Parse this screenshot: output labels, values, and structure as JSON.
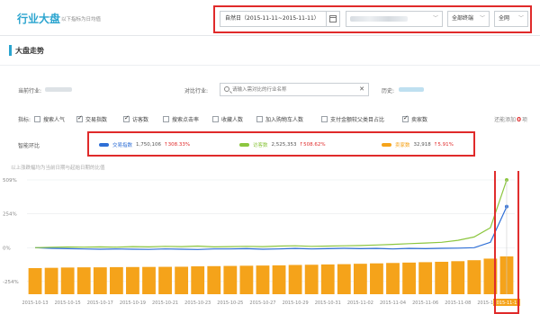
{
  "header": {
    "title": "行业大盘",
    "subtitle": "以下指标为日均值",
    "date_range": "自然日（2015-11-11~2015-11-11）",
    "industry_placeholder": "",
    "terminal_select": "全部终端",
    "scope_select": "全网"
  },
  "section": {
    "title": "大盘走势"
  },
  "filters": {
    "current_industry_label": "当前行业:",
    "compare_industry_label": "对比行业:",
    "compare_search_placeholder": "请输入需对比的行业名称",
    "history_label": "历史:"
  },
  "metrics": {
    "label": "指标:",
    "items": [
      {
        "label": "搜索人气",
        "checked": false
      },
      {
        "label": "交易指数",
        "checked": true
      },
      {
        "label": "访客数",
        "checked": true
      },
      {
        "label": "搜索点击率",
        "checked": false
      },
      {
        "label": "收藏人数",
        "checked": false
      },
      {
        "label": "加入购物车人数",
        "checked": false
      },
      {
        "label": "支付金额较父类目占比",
        "checked": false
      },
      {
        "label": "卖家数",
        "checked": true
      }
    ],
    "count_prefix": "还能添加",
    "count": "0",
    "count_suffix": "项"
  },
  "smart_compare": {
    "label": "智能环比",
    "series": [
      {
        "name": "交易指数",
        "value": "1,750,106",
        "change": "↑308.33%",
        "color": "#2f6fd6"
      },
      {
        "name": "访客数",
        "value": "2,525,353",
        "change": "↑508.62%",
        "color": "#8cc63f"
      },
      {
        "name": "卖家数",
        "value": "32,918",
        "change": "↑5.91%",
        "color": "#f5a31a"
      }
    ]
  },
  "chart_data": {
    "type": "bar",
    "note": "以上涨跌幅均为当前日期与起始日期的比值",
    "y_ticks": [
      "509%",
      "254%",
      "0%",
      "-254%"
    ],
    "ylim": [
      -350,
      509
    ],
    "x": [
      "2015-10-13",
      "2015-10-14",
      "2015-10-15",
      "2015-10-16",
      "2015-10-17",
      "2015-10-18",
      "2015-10-19",
      "2015-10-20",
      "2015-10-21",
      "2015-10-22",
      "2015-10-23",
      "2015-10-24",
      "2015-10-25",
      "2015-10-26",
      "2015-10-27",
      "2015-10-28",
      "2015-10-29",
      "2015-10-30",
      "2015-10-31",
      "2015-11-01",
      "2015-11-02",
      "2015-11-03",
      "2015-11-04",
      "2015-11-05",
      "2015-11-06",
      "2015-11-07",
      "2015-11-08",
      "2015-11-09",
      "2015-11-10",
      "2015-11-11"
    ],
    "x_tick_labels": [
      "2015-10-13",
      "2015-10-15",
      "2015-10-17",
      "2015-10-19",
      "2015-10-21",
      "2015-10-23",
      "2015-10-25",
      "2015-10-27",
      "2015-10-29",
      "2015-10-31",
      "2015-11-02",
      "2015-11-04",
      "2015-11-06",
      "2015-11-08",
      "2015-11-10",
      "2015-11-11"
    ],
    "bars": {
      "name": "卖家数",
      "values": [
        0.0,
        0.15,
        0.3,
        0.4,
        0.4,
        0.5,
        0.55,
        0.6,
        0.65,
        0.7,
        0.9,
        1.0,
        1.1,
        1.2,
        1.3,
        1.4,
        1.6,
        1.7,
        1.85,
        2.0,
        2.2,
        2.4,
        2.6,
        2.8,
        3.0,
        3.2,
        3.5,
        4.0,
        4.8,
        5.91
      ],
      "unit": "%"
    },
    "lines": [
      {
        "name": "交易指数",
        "values": [
          0,
          -5,
          -8,
          -10,
          -12,
          -10,
          -12,
          -13,
          -10,
          -12,
          -14,
          -10,
          -10,
          -8,
          -12,
          -10,
          -6,
          -10,
          -8,
          -5,
          -8,
          -6,
          -10,
          -6,
          -8,
          -5,
          -4,
          0,
          40,
          308.33
        ],
        "color": "#2f6fd6"
      },
      {
        "name": "访客数",
        "values": [
          0,
          3,
          5,
          4,
          6,
          4,
          8,
          6,
          10,
          8,
          12,
          6,
          8,
          10,
          8,
          12,
          14,
          10,
          12,
          14,
          16,
          20,
          25,
          30,
          35,
          40,
          55,
          80,
          150,
          508.62
        ],
        "color": "#8cc63f"
      }
    ],
    "highlight_last": true
  }
}
